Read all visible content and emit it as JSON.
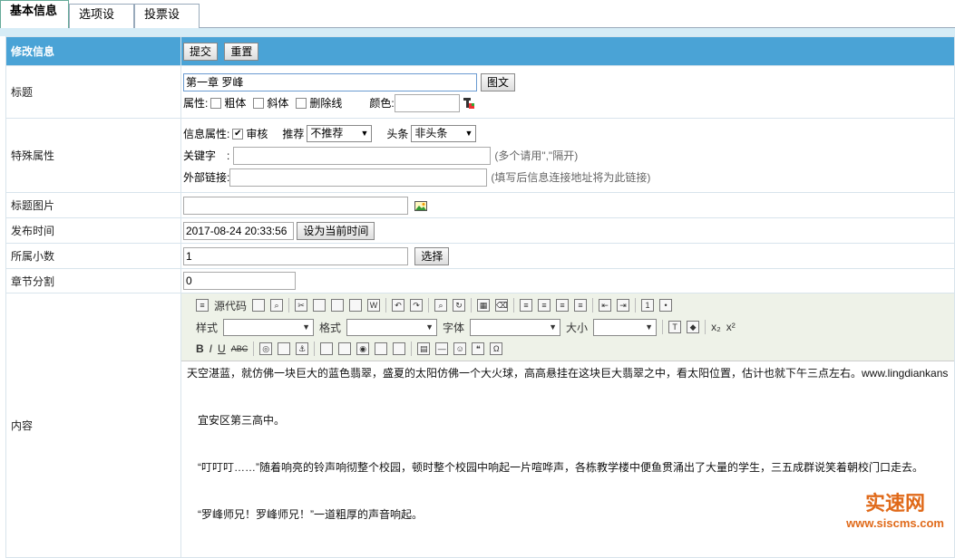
{
  "tabs": [
    "基本信息",
    "选项设置",
    "投票设置"
  ],
  "header": {
    "title": "修改信息",
    "submit": "提交",
    "reset": "重置"
  },
  "title_row": {
    "label": "标题",
    "value": "第一章 罗峰",
    "pic_button": "图文",
    "attr_label": "属性:",
    "bold": "粗体",
    "italic": "斜体",
    "strike": "删除线",
    "color_label": "颜色:"
  },
  "special": {
    "label": "特殊属性",
    "info_attr": "信息属性:",
    "audit": "审核",
    "recommend_label": "推荐",
    "recommend_value": "不推荐",
    "headline_label": "头条",
    "headline_value": "非头条",
    "keywords_label": "关键字　:",
    "keywords_hint": "(多个请用\",\"隔开)",
    "link_label": "外部链接:",
    "link_hint": "(填写后信息连接地址将为此链接)"
  },
  "title_pic": {
    "label": "标题图片"
  },
  "publish": {
    "label": "发布时间",
    "value": "2017-08-24 20:33:56",
    "now_button": "设为当前时间"
  },
  "volume": {
    "label": "所属小数",
    "value": "1",
    "choose_button": "选择"
  },
  "chapter": {
    "label": "章节分割",
    "value": "0"
  },
  "content": {
    "label": "内容",
    "toolbar": {
      "source": "源代码",
      "style": "样式",
      "format": "格式",
      "font": "字体",
      "size": "大小"
    },
    "paragraphs": [
      "天空湛蓝，就仿佛一块巨大的蓝色翡翠，盛夏的太阳仿佛一个大火球，高高悬挂在这块巨大翡翠之中，看太阳位置，估计也就下午三点左右。www.lingdiankans",
      "　宜安区第三高中。",
      "　“叮叮叮……”随着响亮的铃声响彻整个校园，顿时整个校园中响起一片喧哗声，各栋教学楼中便鱼贯涌出了大量的学生，三五成群说笑着朝校门口走去。",
      "　“罗峰师兄！罗峰师兄！”一道粗厚的声音响起。"
    ]
  },
  "watermark": {
    "cn": "实速网",
    "url": "www.siscms.com"
  },
  "colors": {
    "header_bg": "#4aa3d6",
    "watermark": "#e06a1a"
  }
}
